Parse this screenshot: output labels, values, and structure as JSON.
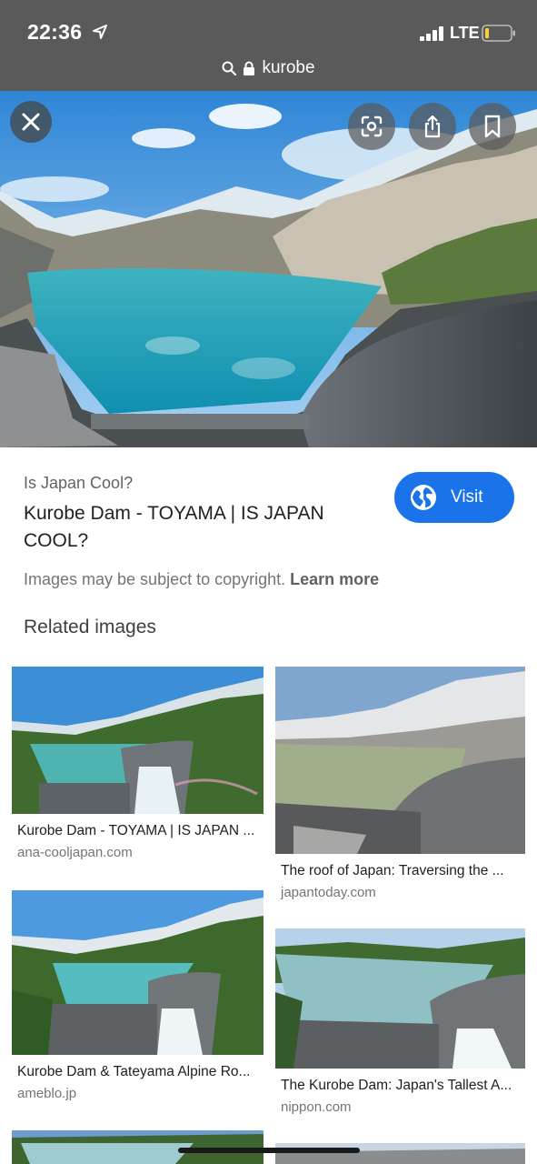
{
  "status_bar": {
    "time": "22:36",
    "network": "LTE"
  },
  "url_bar": {
    "query": "kurobe"
  },
  "hero": {
    "close_label": "close",
    "lens_label": "lens",
    "share_label": "share",
    "save_label": "save"
  },
  "info": {
    "site_name": "Is Japan Cool?",
    "title": "Kurobe Dam - TOYAMA | IS JAPAN COOL?",
    "visit_label": "Visit",
    "copyright_text": "Images may be subject to copyright.",
    "learn_more": "Learn more"
  },
  "related": {
    "heading": "Related images",
    "items": [
      {
        "title": "Kurobe Dam - TOYAMA | IS JAPAN ...",
        "source": "ana-cooljapan.com"
      },
      {
        "title": "The roof of Japan: Traversing the ...",
        "source": "japantoday.com"
      },
      {
        "title": "Kurobe Dam & Tateyama Alpine Ro...",
        "source": "ameblo.jp"
      },
      {
        "title": "The Kurobe Dam: Japan's Tallest A...",
        "source": "nippon.com"
      }
    ]
  }
}
